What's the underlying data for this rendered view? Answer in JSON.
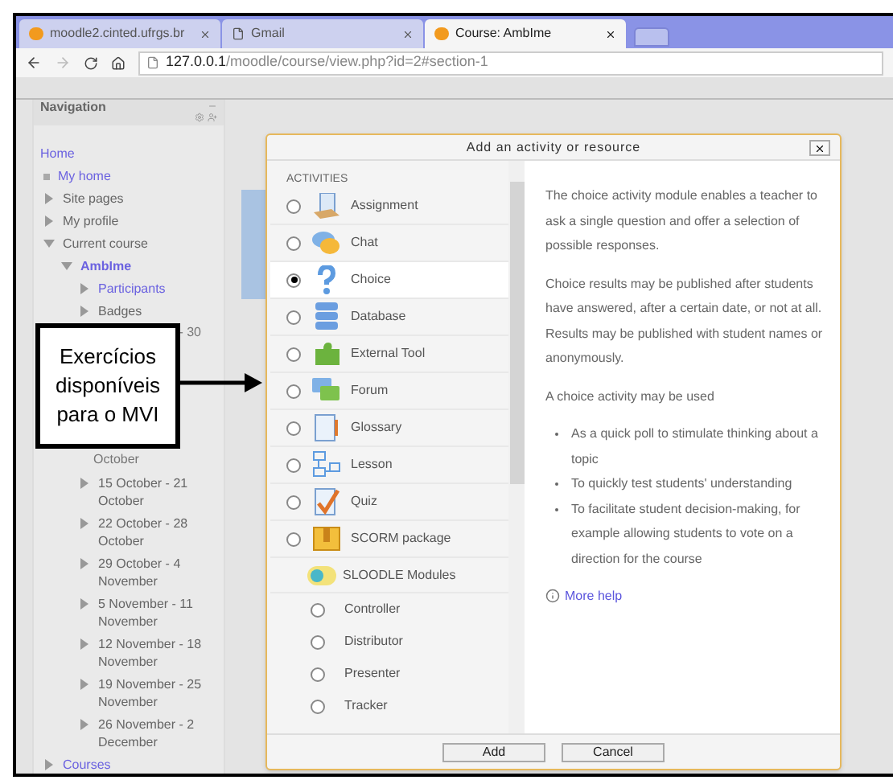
{
  "browser": {
    "tabs": [
      {
        "title": "moodle2.cinted.ufrgs.br",
        "selected": false
      },
      {
        "title": "Gmail",
        "selected": false
      },
      {
        "title": "Course: AmbIme",
        "selected": true
      }
    ],
    "address": {
      "host": "127.0.0.1",
      "path": "/moodle/course/view.php?id=2#section-1"
    }
  },
  "navigation": {
    "title": "Navigation",
    "home": "Home",
    "items": [
      {
        "label": "My home",
        "kind": "link"
      },
      {
        "label": "Site pages",
        "kind": "node",
        "expanded": false
      },
      {
        "label": "My profile",
        "kind": "node",
        "expanded": false
      },
      {
        "label": "Current course",
        "kind": "node",
        "expanded": true,
        "children": [
          {
            "label": "AmbIme",
            "kind": "course",
            "expanded": true,
            "children": [
              {
                "label": "Participants",
                "kind": "linknode",
                "expanded": false
              },
              {
                "label": "Badges",
                "kind": "node",
                "expanded": false
              },
              {
                "label": "- 30",
                "kind": "fragment"
              },
              {
                "label": "October",
                "kind": "fragment_tail"
              },
              {
                "label": "15 October - 21 October",
                "kind": "node",
                "expanded": false
              },
              {
                "label": "22 October - 28 October",
                "kind": "node",
                "expanded": false
              },
              {
                "label": "29 October - 4 November",
                "kind": "node",
                "expanded": false
              },
              {
                "label": "5 November - 11 November",
                "kind": "node",
                "expanded": false
              },
              {
                "label": "12 November - 18 November",
                "kind": "node",
                "expanded": false
              },
              {
                "label": "19 November - 25 November",
                "kind": "node",
                "expanded": false
              },
              {
                "label": "26 November - 2 December",
                "kind": "node",
                "expanded": false
              }
            ]
          }
        ]
      },
      {
        "label": "Courses",
        "kind": "linknode",
        "expanded": false
      }
    ]
  },
  "dialog": {
    "title": "Add an activity or resource",
    "section": "ACTIVITIES",
    "items": [
      {
        "label": "Assignment",
        "kind": "module",
        "selected": false
      },
      {
        "label": "Chat",
        "kind": "module",
        "selected": false
      },
      {
        "label": "Choice",
        "kind": "module",
        "selected": true
      },
      {
        "label": "Database",
        "kind": "module",
        "selected": false
      },
      {
        "label": "External Tool",
        "kind": "module",
        "selected": false
      },
      {
        "label": "Forum",
        "kind": "module",
        "selected": false
      },
      {
        "label": "Glossary",
        "kind": "module",
        "selected": false
      },
      {
        "label": "Lesson",
        "kind": "module",
        "selected": false
      },
      {
        "label": "Quiz",
        "kind": "module",
        "selected": false
      },
      {
        "label": "SCORM package",
        "kind": "module",
        "selected": false
      },
      {
        "label": "SLOODLE Modules",
        "kind": "group"
      },
      {
        "label": "Controller",
        "kind": "subitem",
        "selected": false
      },
      {
        "label": "Distributor",
        "kind": "subitem",
        "selected": false
      },
      {
        "label": "Presenter",
        "kind": "subitem",
        "selected": false
      },
      {
        "label": "Tracker",
        "kind": "subitem",
        "selected": false
      }
    ],
    "description": [
      "The choice activity module enables a teacher to ask a single question and offer a selection of possible responses.",
      "Choice results may be published after students have answered, after a certain date, or not at all. Results may be published with student names or anonymously.",
      "A choice activity may be used"
    ],
    "bullets": [
      "As a quick poll to stimulate thinking about a topic",
      "To quickly test students' understanding",
      "To facilitate student decision-making, for example allowing students to vote on a direction for the course"
    ],
    "help_link": "More help",
    "buttons": [
      "Add",
      "Cancel"
    ]
  },
  "callout": "Exercícios disponíveis para o MVI"
}
